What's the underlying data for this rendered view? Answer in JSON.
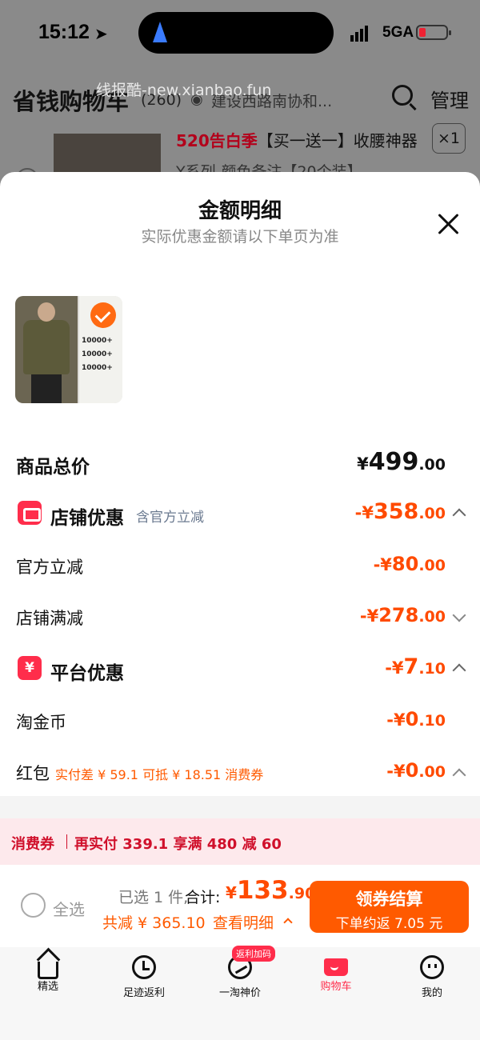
{
  "status_bar": {
    "time": "15:12",
    "network": "5GA"
  },
  "background": {
    "page_title": "省钱购物车",
    "count": "(260)",
    "address": "建设西路南协和...",
    "watermark": "线报酷-new.xianbao.fun",
    "manage": "管理",
    "product_title_prefix": "520告白季",
    "product_title_rest": "【买一送一】收腰神器",
    "quantity": "×1",
    "spec": "Y系列-颜色备注【20个装】"
  },
  "sheet": {
    "title": "金额明细",
    "subtitle": "实际优惠金额请以下单页为准",
    "product_image": {
      "lines": [
        "10000+",
        "10000+",
        "10000+"
      ]
    },
    "rows": {
      "total": {
        "label": "商品总价",
        "cur": "¥",
        "int": "499",
        "dec": ".00"
      },
      "shop": {
        "label": "店铺优惠",
        "tag": "含官方立减",
        "cur": "-¥",
        "int": "358",
        "dec": ".00"
      },
      "official": {
        "label": "官方立减",
        "cur": "-¥",
        "int": "80",
        "dec": ".00"
      },
      "shop_full": {
        "label": "店铺满减",
        "cur": "-¥",
        "int": "278",
        "dec": ".00"
      },
      "platform": {
        "label": "平台优惠",
        "icon": "¥",
        "cur": "-¥",
        "int": "7",
        "dec": ".10"
      },
      "coin": {
        "label": "淘金币",
        "cur": "-¥",
        "int": "0",
        "dec": ".10"
      },
      "redpack": {
        "label": "红包",
        "note": "实付差 ¥ 59.1 可抵 ¥ 18.51 消费券",
        "cur": "-¥",
        "int": "0",
        "dec": ".00"
      }
    }
  },
  "coupon_bar": {
    "label": "消费券",
    "text": "再实付 339.1 享满 480 减 60"
  },
  "checkout": {
    "select_all": "全选",
    "selected": "已选 1 件,",
    "total_label": "合计:",
    "total_cur": "¥",
    "total_int": "133",
    "total_dec": ".90",
    "saved": "共减 ¥ 365.10",
    "detail": "查看明细",
    "pay_label": "领券结算",
    "pay_sub": "下单约返 7.05 元"
  },
  "tabbar": {
    "tabs": [
      {
        "label": "精选",
        "icon": "home-icon"
      },
      {
        "label": "足迹返利",
        "icon": "clock-icon"
      },
      {
        "label": "一淘神价",
        "icon": "trend-icon",
        "badge": "返利加码"
      },
      {
        "label": "购物车",
        "icon": "cart-icon",
        "active": true
      },
      {
        "label": "我的",
        "icon": "face-icon"
      }
    ]
  },
  "colors": {
    "accent": "#ff4a00",
    "brand_red": "#ff2d4b",
    "coupon_bg": "#fde9ec"
  }
}
